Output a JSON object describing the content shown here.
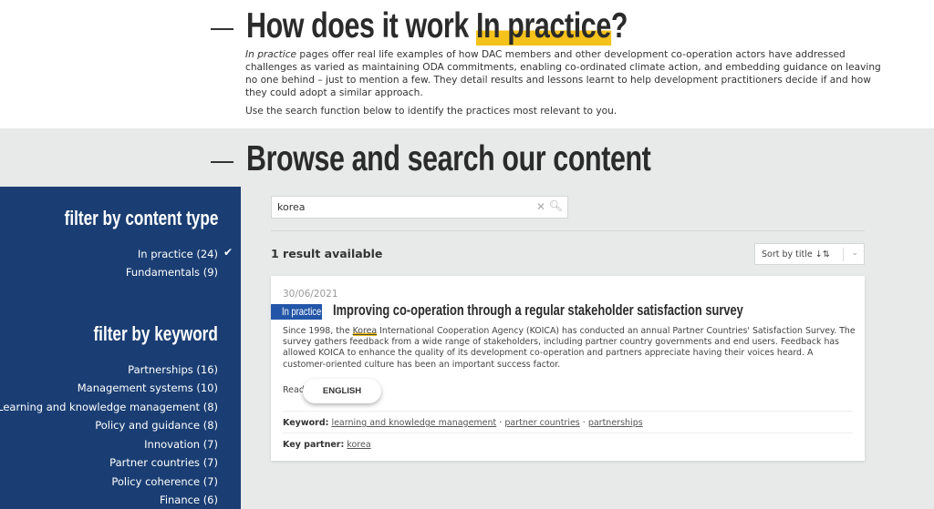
{
  "intro": {
    "title_prefix": "How does it work ",
    "title_highlight": "In practice",
    "title_suffix": "?",
    "p1_em": "In practice",
    "p1_rest": " pages offer real life examples of how DAC members and other development co-operation actors have addressed challenges as varied as maintaining ODA commitments, enabling co-ordinated climate action, and embedding guidance on leaving no one behind – just to mention a few. They detail results and lessons learnt to help development practitioners decide if and how they could adopt a similar approach.",
    "p2": "Use the search function below to identify the practices most relevant to you."
  },
  "browse": {
    "title": "Browse and search our content"
  },
  "sidebar": {
    "content_type_title": "filter by content type",
    "content_types": [
      {
        "label": "In practice (24)",
        "checked": true
      },
      {
        "label": "Fundamentals (9)",
        "checked": false
      }
    ],
    "keyword_title": "filter by keyword",
    "keywords": [
      "Partnerships (16)",
      "Management systems (10)",
      "Learning and knowledge management (8)",
      "Policy and guidance (8)",
      "Innovation (7)",
      "Partner countries (7)",
      "Policy coherence (7)",
      "Finance (6)"
    ]
  },
  "search": {
    "value": "korea",
    "clear_icon": "close-icon",
    "search_icon": "search-icon"
  },
  "results": {
    "count": "1 result available",
    "sort": "Sort by title ↓⇅"
  },
  "card": {
    "date": "30/06/2021",
    "badge": "In practice",
    "title": "Improving co-operation through a regular stakeholder satisfaction survey",
    "desc_before": "Since 1998, the ",
    "desc_kw": "Korea",
    "desc_after": " International Cooperation Agency (KOICA) has conducted an annual Partner Countries' Satisfaction Survey. The survey gathers feedback from a wide range of stakeholders, including partner country governments and end users. Feedback has allowed KOICA to enhance the quality of its development co-operation and partners appreciate having their voices heard. A customer-oriented culture has been an important success factor.",
    "read_in": "Read in",
    "language": "ENGLISH",
    "keyword_label": "Keyword:",
    "keywords": [
      "learning and knowledge management",
      "partner countries",
      "partnerships"
    ],
    "sep": " · ",
    "partner_label": "Key partner:",
    "partner": "korea"
  },
  "colors": {
    "sidebar": "#1a3e73",
    "badge": "#2356a8",
    "highlight": "#f5c21b"
  }
}
